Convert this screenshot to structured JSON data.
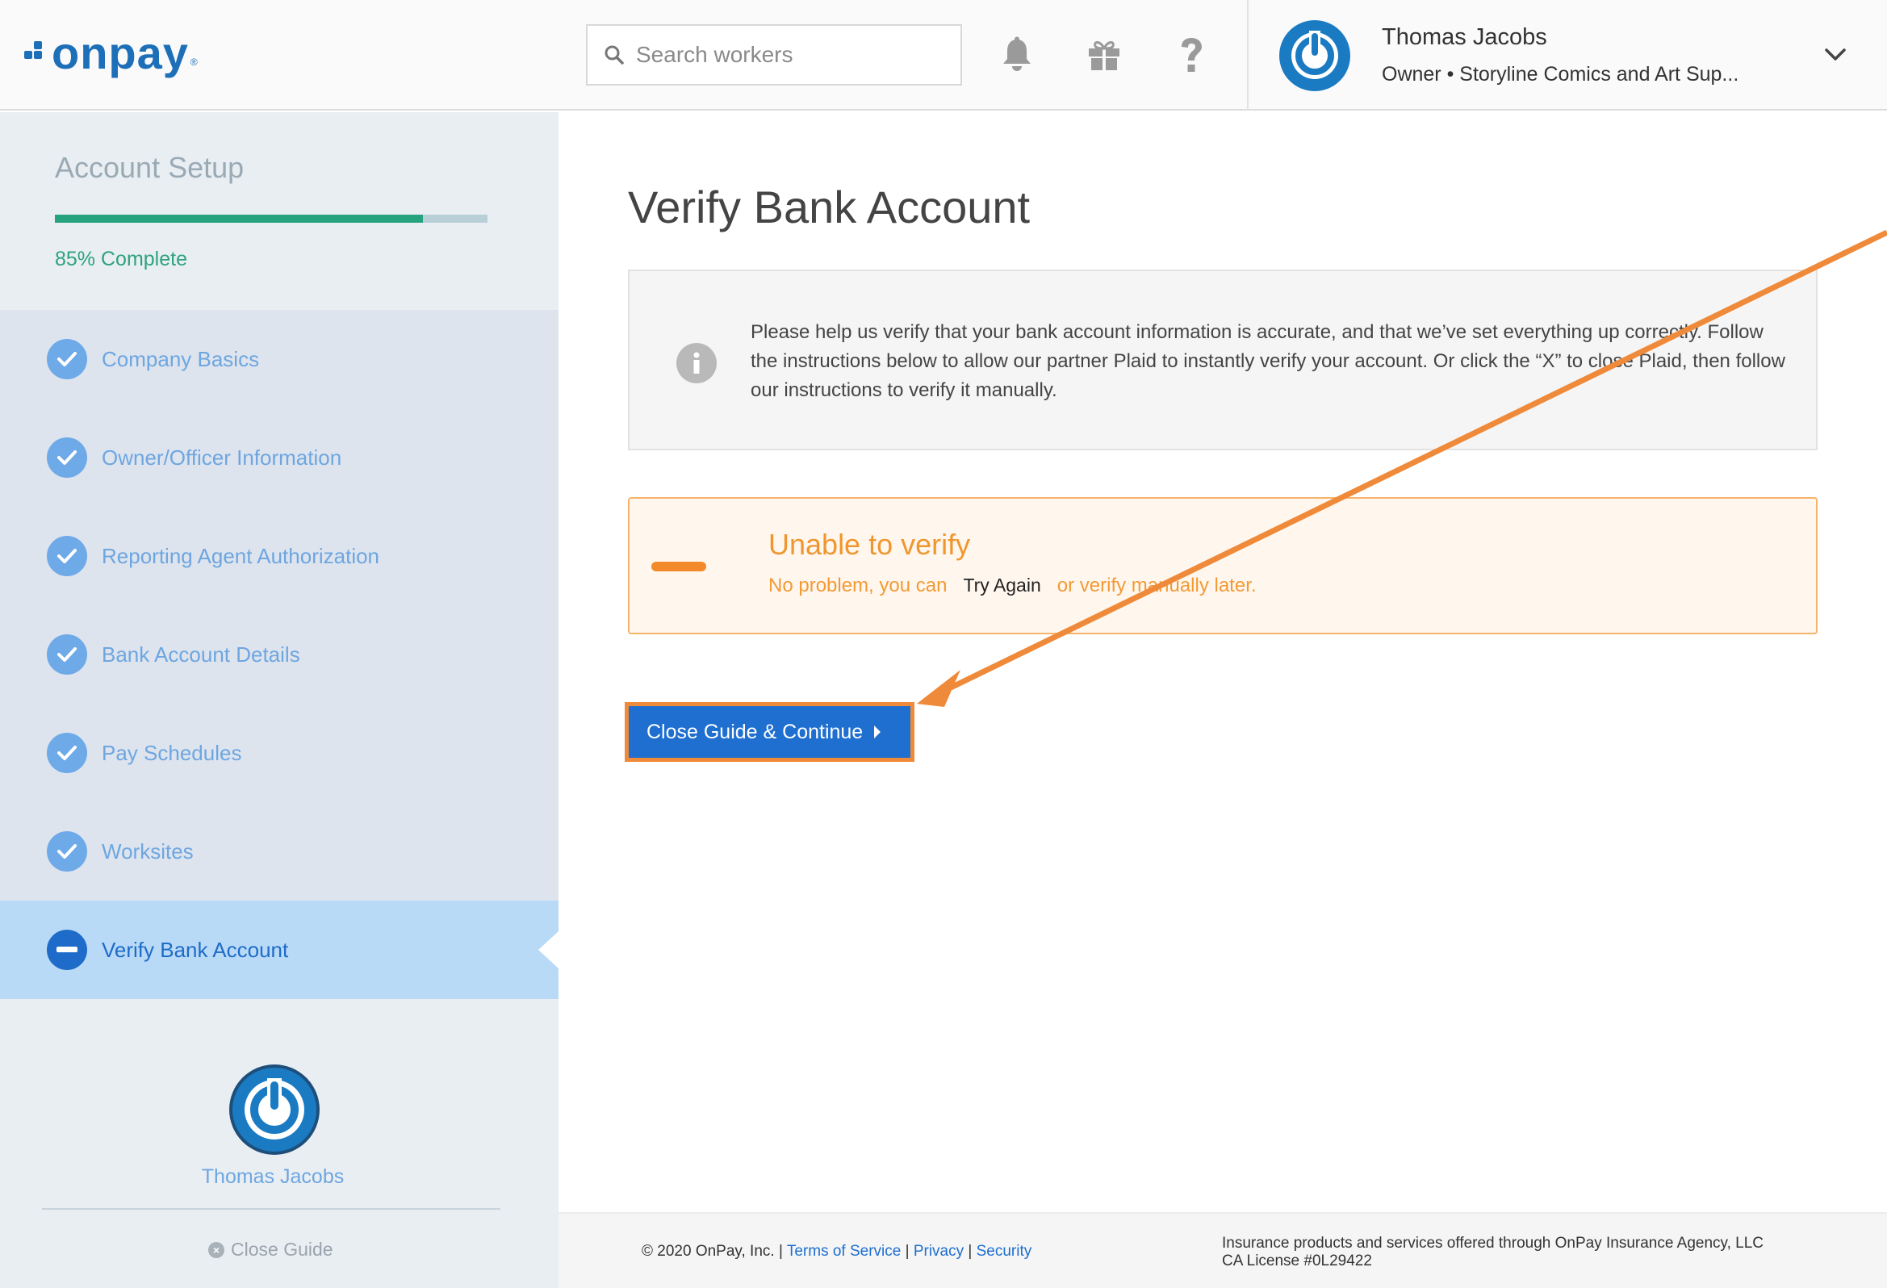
{
  "brand": {
    "logo_text": "onpay",
    "logo_reg": "®",
    "color": "#1d6fb8"
  },
  "header": {
    "search_placeholder": "Search workers",
    "icons": [
      "bell-icon",
      "gift-icon",
      "help-icon"
    ],
    "user": {
      "name": "Thomas Jacobs",
      "subtitle": "Owner • Storyline Comics and Art Sup..."
    }
  },
  "sidebar": {
    "title": "Account Setup",
    "progress_fraction": 0.85,
    "progress_label": "85% Complete",
    "steps": [
      {
        "label": "Company Basics",
        "status": "complete"
      },
      {
        "label": "Owner/Officer Information",
        "status": "complete"
      },
      {
        "label": "Reporting Agent Authorization",
        "status": "complete"
      },
      {
        "label": "Bank Account Details",
        "status": "complete"
      },
      {
        "label": "Pay Schedules",
        "status": "complete"
      },
      {
        "label": "Worksites",
        "status": "complete"
      },
      {
        "label": "Verify Bank Account",
        "status": "in-progress"
      }
    ],
    "user_name": "Thomas Jacobs",
    "close_guide": "Close Guide"
  },
  "main": {
    "title": "Verify Bank Account",
    "info_text": "Please help us verify that your bank account information is accurate, and that we’ve set everything up correctly. Follow the instructions below to allow our partner Plaid to instantly verify your account. Or click the “X” to close Plaid, then follow our instructions to verify it manually.",
    "warning": {
      "title": "Unable to verify",
      "text_before": "No problem, you can",
      "link": "Try Again",
      "text_after": "or verify manually later."
    },
    "cta_label": "Close Guide & Continue"
  },
  "footer": {
    "copyright": "© 2020 OnPay, Inc. |",
    "terms": "Terms of Service",
    "sep1": "|",
    "privacy": "Privacy",
    "sep2": "|",
    "security": "Security",
    "insurance_line1": "Insurance products and services offered through OnPay Insurance Agency, LLC",
    "insurance_line2": "CA License #0L29422"
  },
  "colors": {
    "primary": "#1e6fd0",
    "success": "#26a27e",
    "warning": "#f0962e",
    "annotation": "#ef8a3a"
  }
}
